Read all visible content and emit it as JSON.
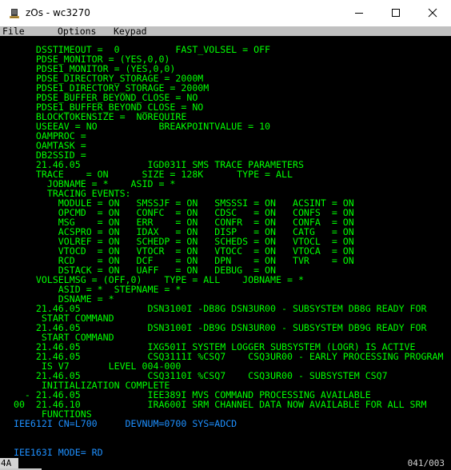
{
  "window": {
    "title": "zOs - wc3270",
    "icon": "terminal-app-icon",
    "controls": {
      "minimize": "minimize-icon",
      "maximize": "maximize-icon",
      "close": "close-icon"
    }
  },
  "menu": {
    "items": [
      {
        "label": "File"
      },
      {
        "label": "Options"
      },
      {
        "label": "Keypad"
      }
    ]
  },
  "screen": {
    "colors": {
      "output": "#00ff00",
      "system": "#1e90ff",
      "background": "#000000"
    },
    "lines": [
      {
        "text": "      DSSTIMEOUT =  0          FAST_VOLSEL = OFF",
        "color": "g"
      },
      {
        "text": "      PDSE_MONITOR = (YES,0,0)",
        "color": "g"
      },
      {
        "text": "      PDSE1_MONITOR = (YES,0,0)",
        "color": "g"
      },
      {
        "text": "      PDSE_DIRECTORY_STORAGE = 2000M",
        "color": "g"
      },
      {
        "text": "      PDSE1_DIRECTORY_STORAGE = 2000M",
        "color": "g"
      },
      {
        "text": "      PDSE_BUFFER_BEYOND_CLOSE = NO",
        "color": "g"
      },
      {
        "text": "      PDSE1_BUFFER_BEYOND_CLOSE = NO",
        "color": "g"
      },
      {
        "text": "      BLOCKTOKENSIZE =  NOREQUIRE",
        "color": "g"
      },
      {
        "text": "      USEEAV = NO           BREAKPOINTVALUE = 10",
        "color": "g"
      },
      {
        "text": "      OAMPROC =",
        "color": "g"
      },
      {
        "text": "      OAMTASK =",
        "color": "g"
      },
      {
        "text": "      DB2SSID =",
        "color": "g"
      },
      {
        "text": "      21.46.05            IGD031I SMS TRACE PARAMETERS",
        "color": "g"
      },
      {
        "text": "      TRACE    = ON      SIZE = 128K      TYPE = ALL",
        "color": "g"
      },
      {
        "text": "        JOBNAME = *    ASID = *",
        "color": "g"
      },
      {
        "text": "        TRACING EVENTS:",
        "color": "g"
      },
      {
        "text": "          MODULE = ON   SMSSJF = ON   SMSSSI = ON   ACSINT = ON",
        "color": "g"
      },
      {
        "text": "          OPCMD  = ON   CONFC  = ON   CDSC   = ON   CONFS  = ON",
        "color": "g"
      },
      {
        "text": "          MSG    = ON   ERR    = ON   CONFR  = ON   CONFA  = ON",
        "color": "g"
      },
      {
        "text": "          ACSPRO = ON   IDAX   = ON   DISP   = ON   CATG   = ON",
        "color": "g"
      },
      {
        "text": "          VOLREF = ON   SCHEDP = ON   SCHEDS = ON   VTOCL  = ON",
        "color": "g"
      },
      {
        "text": "          VTOCD  = ON   VTOCR  = ON   VTOCC  = ON   VTOCA  = ON",
        "color": "g"
      },
      {
        "text": "          RCD    = ON   DCF    = ON   DPN    = ON   TVR    = ON",
        "color": "g"
      },
      {
        "text": "          DSTACK = ON   UAFF   = ON   DEBUG  = ON",
        "color": "g"
      },
      {
        "text": "      VOLSELMSG = (OFF,0)    TYPE = ALL    JOBNAME = *",
        "color": "g"
      },
      {
        "text": "          ASID = *  STEPNAME = *",
        "color": "g"
      },
      {
        "text": "          DSNAME = *",
        "color": "g"
      },
      {
        "text": "      21.46.05            DSN3100I -DB8G DSN3UR00 - SUBSYSTEM DB8G READY FOR",
        "color": "g"
      },
      {
        "text": "       START COMMAND",
        "color": "g"
      },
      {
        "text": "      21.46.05            DSN3100I -DB9G DSN3UR00 - SUBSYSTEM DB9G READY FOR",
        "color": "g"
      },
      {
        "text": "       START COMMAND",
        "color": "g"
      },
      {
        "text": "      21.46.05            IXG501I SYSTEM LOGGER SUBSYSTEM (LOGR) IS ACTIVE",
        "color": "g"
      },
      {
        "text": "      21.46.05            CSQ3111I %CSQ7    CSQ3UR00 - EARLY PROCESSING PROGRAM",
        "color": "g"
      },
      {
        "text": "       IS V7       LEVEL 004-000",
        "color": "g"
      },
      {
        "text": "      21.46.05            CSQ3110I %CSQ7    CSQ3UR00 - SUBSYSTEM CSQ7",
        "color": "g"
      },
      {
        "text": "       INITIALIZATION COMPLETE",
        "color": "g"
      },
      {
        "text": "    - 21.46.05            IEE389I MVS COMMAND PROCESSING AVAILABLE",
        "color": "g"
      },
      {
        "text": "  00  21.46.10            IRA600I SRM CHANNEL DATA NOW AVAILABLE FOR ALL SRM",
        "color": "g"
      },
      {
        "text": "       FUNCTIONS",
        "color": "g"
      },
      {
        "text": "  IEE612I CN=L700     DEVNUM=0700 SYS=ADCD",
        "color": "b"
      },
      {
        "text": "",
        "color": "g"
      },
      {
        "text": "",
        "color": "g"
      },
      {
        "text": "  IEE163I MODE= RD",
        "color": "b"
      }
    ]
  },
  "status": {
    "left": "4A",
    "cursor_position": "041/003"
  }
}
